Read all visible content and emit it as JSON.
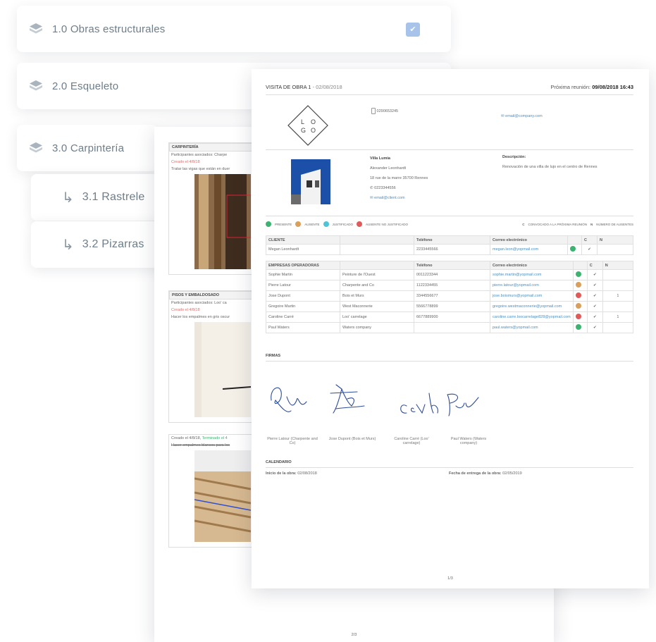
{
  "tree": {
    "items": [
      {
        "label": "1.0 Obras estructurales",
        "checked": true
      },
      {
        "label": "2.0 Esqueleto"
      },
      {
        "label": "3.0 Carpintería"
      }
    ],
    "subitems": [
      {
        "label": "3.1 Rastrele"
      },
      {
        "label": "3.2 Pizarras"
      }
    ]
  },
  "page2": {
    "sections": [
      {
        "heading": "CARPINTERÍA",
        "participants": "Participantes asociados: Charpe",
        "created": "Creado el 4/8/18",
        "note": "Tratar las vigas que están en duer"
      },
      {
        "heading": "PISOS Y EMBALDOSADO",
        "participants": "Participantes asociados: Loo' ca",
        "created": "Creado el 4/8/18",
        "note": "Hacer los empalmes en gris oscur"
      },
      {
        "created": "Creado el 4/8/18,",
        "created_done": "Terminado el 4",
        "note": "Hacer empalmes blancos para los"
      }
    ],
    "page_num": "2/3"
  },
  "page1": {
    "title": "VISITA DE OBRA 1",
    "date": "- 02/08/2018",
    "next_label": "Próxima reunión:",
    "next_value": "09/08/2018 16:43",
    "logo": "L O G O",
    "company_phone": "0290653245",
    "company_email": "email@company.com",
    "client": {
      "name": "Villa Lumia",
      "person": "Alexander Leonhardt",
      "address": "18 rue de la marre 35700 Rennes",
      "phone": "0223344556",
      "email": "email@client.com"
    },
    "description_label": "Descripción:",
    "description": "Renovación de una villa de lujo en el centro de Rennes",
    "legend": {
      "present": "PRESENTE",
      "absent": "AUSENTE",
      "justified": "JUSTIFICADO",
      "unjustified": "AUSENTE NO JUSTIFICADO",
      "c_key": "C",
      "c_label": "CONVOCADO A LA PRÓXIMA REUNIÓN",
      "n_key": "N",
      "n_label": "NÚMERO DE AUSENTES"
    },
    "client_table": {
      "headers": [
        "CLIENTE",
        "",
        "Teléfono",
        "Correo electrónico",
        "",
        "C",
        "N"
      ],
      "rows": [
        {
          "name": "Megan Leonhardt",
          "company": "",
          "phone": "2233445566",
          "email": "megan.leon@yopmail.com",
          "status": "present",
          "c": "✔",
          "n": ""
        }
      ]
    },
    "companies_table": {
      "headers": [
        "EMPRESAS OPERADORAS",
        "",
        "Teléfono",
        "Correo electrónico",
        "",
        "C",
        "N"
      ],
      "rows": [
        {
          "name": "Sophie Martin",
          "company": "Peinture de l'Ouest",
          "phone": "0011223344",
          "email": "sophie.martin@yopmail.com",
          "status": "present",
          "c": "✔",
          "n": ""
        },
        {
          "name": "Pierre Latour",
          "company": "Charpente and Co",
          "phone": "1122334455",
          "email": "pierre.latour@yopmail.com",
          "status": "absent",
          "c": "✔",
          "n": ""
        },
        {
          "name": "Jose Dupont",
          "company": "Bois et Murs",
          "phone": "3344556677",
          "email": "jose.boismurs@yopmail.com",
          "status": "unjustified",
          "c": "✔",
          "n": "1"
        },
        {
          "name": "Gregoire Martin",
          "company": "West Maconnerie",
          "phone": "5566778899",
          "email": "gregoire.westmaconnerie@yopmail.com",
          "status": "absent",
          "c": "✔",
          "n": ""
        },
        {
          "name": "Caroline Carré",
          "company": "Loo' carrelage",
          "phone": "6677889900",
          "email": "caroline.carre.loocarrelage828@yopmail.com",
          "status": "unjustified",
          "c": "✔",
          "n": "1"
        },
        {
          "name": "Paul Waters",
          "company": "Waters company",
          "phone": "",
          "email": "paul.waters@yopmail.com",
          "status": "present",
          "c": "✔",
          "n": ""
        }
      ]
    },
    "signatures_label": "FIRMAS",
    "signatures": [
      {
        "name": "Pierre Latour (Charpente and Co)"
      },
      {
        "name": "Jose Dupont (Bois et Murs)"
      },
      {
        "name": "Caroline Carré (Loo' carrelage)"
      },
      {
        "name": "Paul Waters (Waters company)"
      }
    ],
    "calendar_label": "CALENDARIO",
    "start_label": "Inicio de la obra:",
    "start_date": "02/08/2018",
    "delivery_label": "Fecha de entrega de la obra:",
    "delivery_date": "02/05/2019",
    "page_num": "1/3"
  },
  "colors": {
    "present": "#3cb371",
    "absent": "#d9a05b",
    "justified": "#4fc3d9",
    "unjustified": "#e05a5a",
    "checkbox": "#a7c3ea",
    "link": "#4a90c2"
  }
}
